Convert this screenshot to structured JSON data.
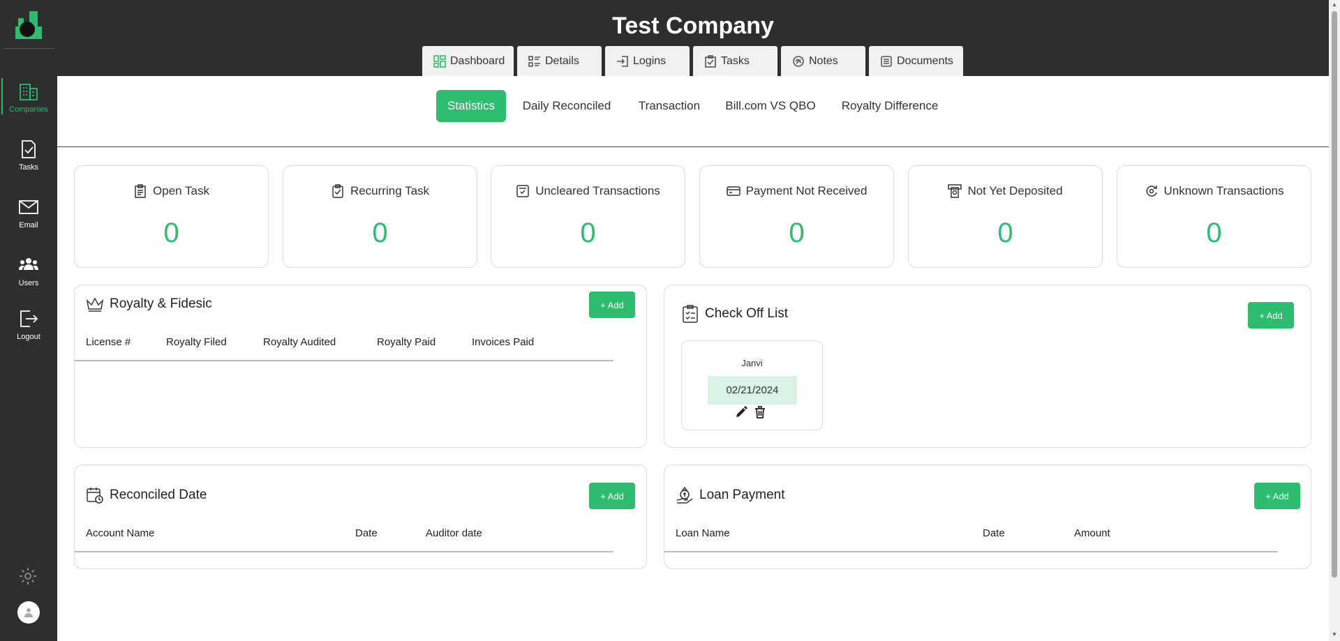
{
  "header": {
    "company_title": "Test Company"
  },
  "sidebar": {
    "items": [
      {
        "label": "Companies",
        "icon": "buildings-icon",
        "active": true
      },
      {
        "label": "Tasks",
        "icon": "task-icon"
      },
      {
        "label": "Email",
        "icon": "mail-icon"
      },
      {
        "label": "Users",
        "icon": "users-icon"
      },
      {
        "label": "Logout",
        "icon": "logout-icon"
      }
    ]
  },
  "top_tabs": [
    "Dashboard",
    "Details",
    "Logins",
    "Tasks",
    "Notes",
    "Documents"
  ],
  "sub_tabs": [
    "Statistics",
    "Daily Reconciled",
    "Transaction",
    "Bill.com VS QBO",
    "Royalty Difference"
  ],
  "stats": [
    {
      "title": "Open Task",
      "value": "0",
      "icon": "clipboard-icon"
    },
    {
      "title": "Recurring Task",
      "value": "0",
      "icon": "clipboard-check-icon"
    },
    {
      "title": "Uncleared Transactions",
      "value": "0",
      "icon": "list-check-icon"
    },
    {
      "title": "Payment Not Received",
      "value": "0",
      "icon": "credit-card-icon"
    },
    {
      "title": "Not Yet Deposited",
      "value": "0",
      "icon": "deposit-icon"
    },
    {
      "title": "Unknown Transactions",
      "value": "0",
      "icon": "unknown-transaction-icon"
    }
  ],
  "royalty": {
    "title": "Royalty & Fidesic",
    "add_label": "+ Add",
    "columns": [
      "License #",
      "Royalty Filed",
      "Royalty Audited",
      "Royalty Paid",
      "Invoices Paid"
    ]
  },
  "checkoff": {
    "title": "Check Off List",
    "add_label": "+ Add",
    "items": [
      {
        "name": "Janvi",
        "date": "02/21/2024"
      }
    ]
  },
  "reconciled": {
    "title": "Reconciled Date",
    "add_label": "+ Add",
    "columns": [
      "Account Name",
      "Date",
      "Auditor date"
    ]
  },
  "loan": {
    "title": "Loan Payment",
    "add_label": "+ Add",
    "columns": [
      "Loan Name",
      "Date",
      "Amount"
    ]
  },
  "colors": {
    "accent": "#2dbd6e",
    "dark": "#2e2e2e"
  }
}
